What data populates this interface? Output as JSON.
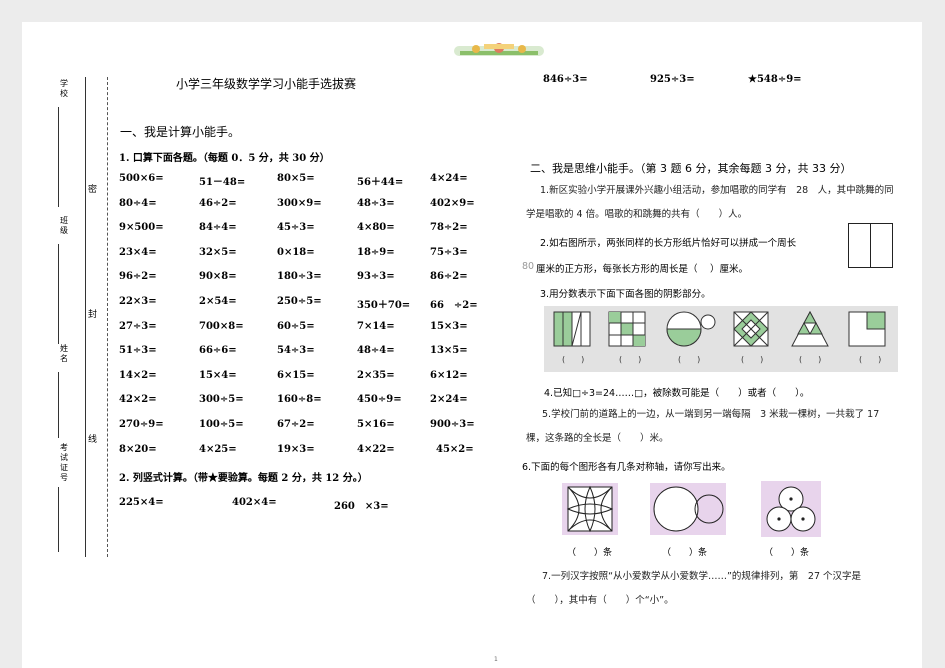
{
  "binding_margin": {
    "labels": [
      "学校",
      "班级",
      "姓名",
      "考试证号"
    ],
    "seal_chars": [
      "密",
      "封",
      "线"
    ]
  },
  "left": {
    "title": "小学三年级数学学习小能手选拔赛",
    "section1": "一、我是计算小能手。",
    "q1_heading": "1. 口算下面各题。（每题 0．5 分，共 30 分）",
    "q1_rows": [
      [
        "500×6=",
        "51－48=",
        "80×5=",
        "56＋44=",
        "4×24="
      ],
      [
        "80÷4=",
        "46÷2=",
        "300×9=",
        "48÷3=",
        "402×9="
      ],
      [
        "9×500=",
        "84÷4=",
        "45÷3=",
        "4×80=",
        "78÷2="
      ],
      [
        "23×4=",
        "32×5=",
        "0×18=",
        "18÷9=",
        "75÷3="
      ],
      [
        "96÷2=",
        "90×8=",
        "180÷3=",
        "93÷3=",
        "86÷2="
      ],
      [
        "22×3=",
        "2×54=",
        "250÷5=",
        "350＋70=",
        "66　÷2="
      ],
      [
        "27÷3=",
        "700×8=",
        "60÷5=",
        "7×14=",
        "15×3="
      ],
      [
        "51÷3=",
        "66÷6=",
        "54÷3=",
        "48÷4=",
        "13×5="
      ],
      [
        "14×2=",
        "15×4=",
        "6×15=",
        "2×35=",
        "6×12="
      ],
      [
        "42×2=",
        "300÷5=",
        "160÷8=",
        "450÷9=",
        "2×24="
      ],
      [
        "270÷9=",
        "100÷5=",
        "67÷2=",
        "5×16=",
        "900÷3="
      ],
      [
        "8×20=",
        "4×25=",
        "19×3=",
        "4×22=",
        "45×2="
      ]
    ],
    "q2_heading": "2. 列竖式计算。（带★要验算。每题 2 分，共 12 分。）",
    "q2_items": [
      "225×4=",
      "402×4=",
      "260　×3="
    ]
  },
  "right": {
    "top_items": [
      "846÷3=",
      "925÷3=",
      "★548÷9="
    ],
    "section2": "二、我是思维小能手。（第 3 题 6 分，其余每题 3 分，共 33 分）",
    "q1": "1.新区实验小学开展课外兴趣小组活动，参加唱歌的同学有　28　人，其中跳舞的同学是唱歌的 4 倍。唱歌的和跳舞的共有（　　）人。",
    "q2_line1": "2.如右图所示，两张同样的长方形纸片恰好可以拼成一个周长",
    "q2_line2_num": "80",
    "q2_line2": "厘米的正方形，每张长方形的周长是（　 ）厘米。",
    "q3": "3.用分数表示下面下面各图的阴影部分。",
    "q3_blank": "(　　)",
    "q4": "4.已知□÷3=24……□，被除数可能是（　　）或者（　　）。",
    "q5": "5.学校门前的道路上的一边，从一端到另一端每隔　3 米栽一棵树，一共栽了 17 棵，这条路的全长是（　　）米。",
    "q6": "6.下面的每个图形各有几条对称轴，请你写出来。",
    "q6_blank": "（　　）条",
    "q7": "7.一列汉字按照“从小爱数学从小爱数学……”的规律排列，第　27 个汉字是（　　），其中有（　　）个“小”。"
  },
  "footer": {
    "page_number": "1"
  }
}
